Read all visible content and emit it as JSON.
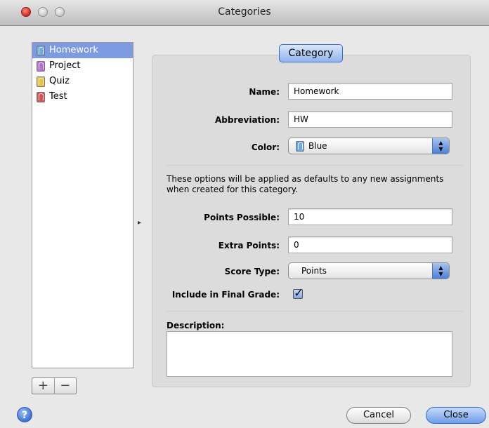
{
  "window": {
    "title": "Categories"
  },
  "categories": [
    {
      "label": "Homework",
      "color": "#6fa8e8",
      "selected": true
    },
    {
      "label": "Project",
      "color": "#b56fd8",
      "selected": false
    },
    {
      "label": "Quiz",
      "color": "#f0c040",
      "selected": false
    },
    {
      "label": "Test",
      "color": "#e05050",
      "selected": false
    }
  ],
  "list_controls": {
    "add": "+",
    "remove": "−"
  },
  "group": {
    "title": "Category"
  },
  "form": {
    "name_label": "Name:",
    "name_value": "Homework",
    "abbreviation_label": "Abbreviation:",
    "abbreviation_value": "HW",
    "color_label": "Color:",
    "color_value": "Blue",
    "color_swatch": "#6fa8e8",
    "info_text": "These options will be applied as defaults to any new assignments when created for this category.",
    "points_possible_label": "Points Possible:",
    "points_possible_value": "10",
    "extra_points_label": "Extra Points:",
    "extra_points_value": "0",
    "score_type_label": "Score Type:",
    "score_type_value": "Points",
    "include_final_label": "Include in Final Grade:",
    "include_final_checked": true,
    "description_label": "Description:",
    "description_value": ""
  },
  "buttons": {
    "help": "?",
    "cancel": "Cancel",
    "close": "Close"
  }
}
